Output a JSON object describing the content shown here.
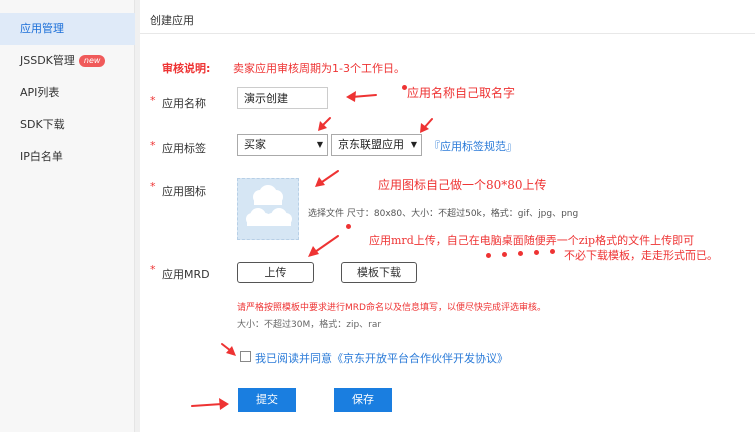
{
  "sidebar": {
    "items": [
      {
        "label": "应用管理",
        "active": true
      },
      {
        "label": "JSSDK管理",
        "badge": "new"
      },
      {
        "label": "API列表"
      },
      {
        "label": "SDK下载"
      },
      {
        "label": "IP白名单"
      }
    ]
  },
  "header": {
    "title": "创建应用"
  },
  "form": {
    "required_mark": "*",
    "notice_label": "审核说明:",
    "notice_text": "卖家应用审核周期为1-3个工作日。",
    "app_name": {
      "label": "应用名称",
      "value": "演示创建"
    },
    "app_tag": {
      "label": "应用标签",
      "select1": "买家",
      "select2": "京东联盟应用",
      "link": "『应用标签规范』"
    },
    "app_icon": {
      "label": "应用图标",
      "hint": "选择文件   尺寸：80x80、大小：不超过50k，格式：gif、jpg、png"
    },
    "app_mrd": {
      "label": "应用MRD",
      "upload_button": "上传",
      "template_button": "模板下载",
      "warning": "请严格按照模板中要求进行MRD命名以及信息填写，以便尽快完成评选审核。",
      "size_hint": "大小：不超过30M，格式：zip、rar"
    },
    "agreement": "我已阅读并同意《京东开放平台合作伙伴开发协议》",
    "submit_button": "提交",
    "save_button": "保存"
  },
  "annotations": {
    "name_note": "应用名称自己取名字",
    "icon_note": "应用图标自己做一个80*80上传",
    "mrd_note_1": "应用mrd上传，自己在电脑桌面随便弄一个zip格式的文件上传即可",
    "mrd_note_2": "不必下载模板，走走形式而已。"
  },
  "colors": {
    "accent": "#1a7ee0",
    "annotation": "#e33333",
    "active_bg": "#dfeaf8"
  }
}
